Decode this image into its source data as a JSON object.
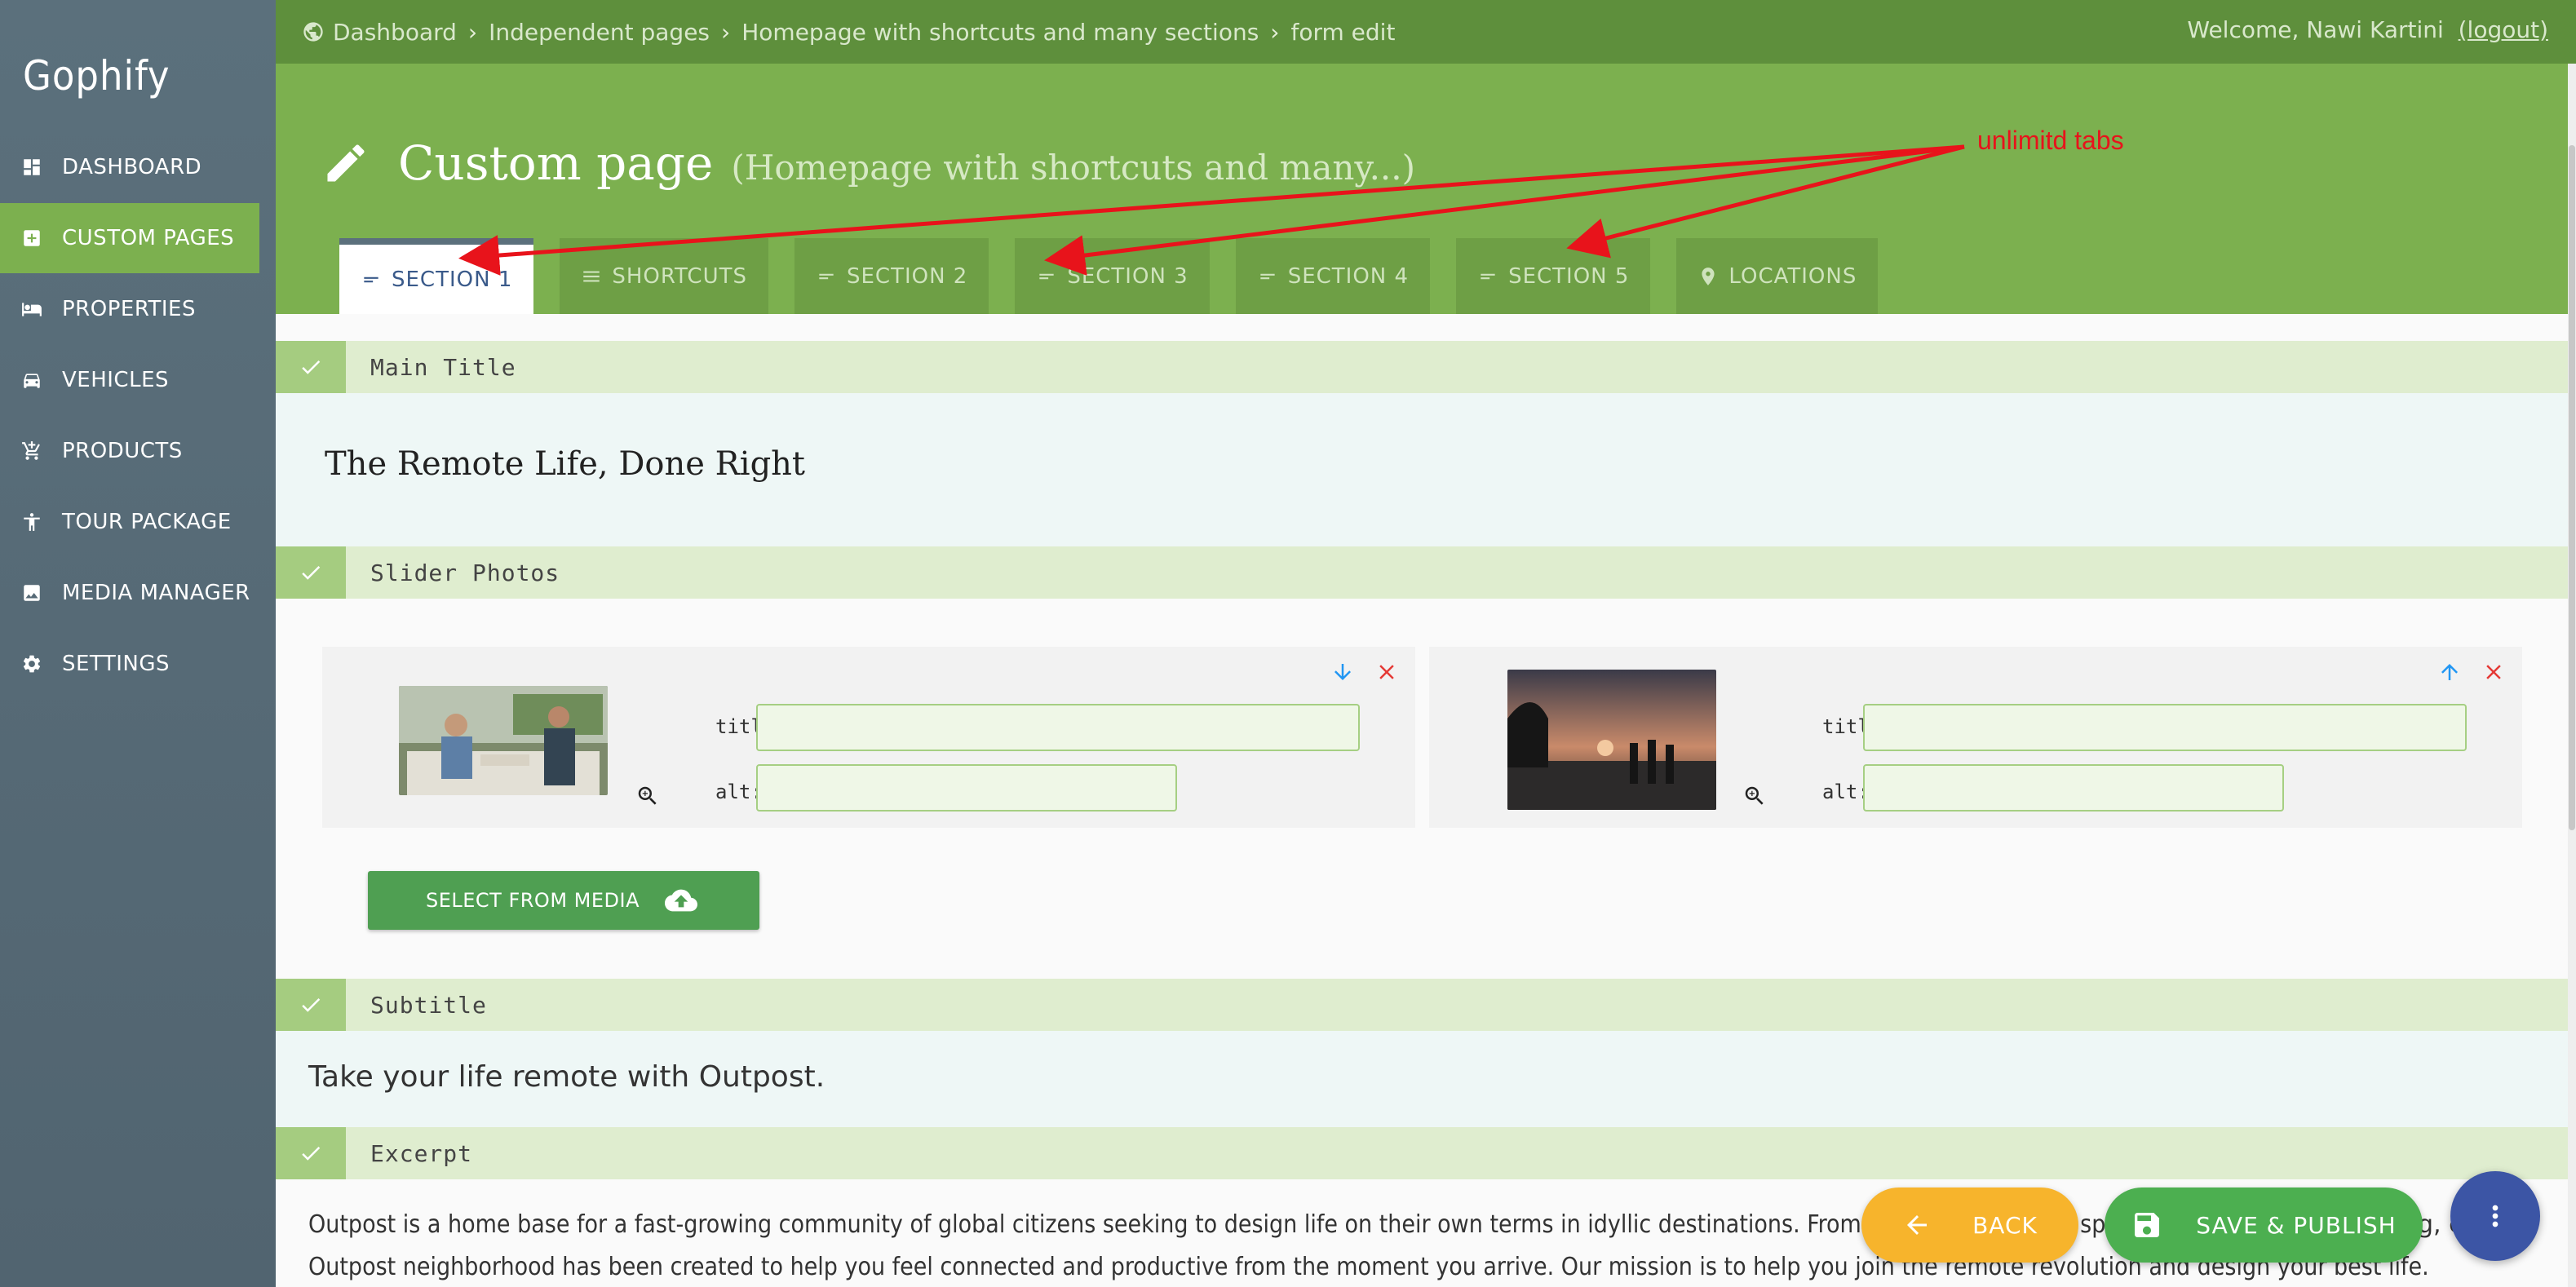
{
  "sidebar": {
    "brand": "Gophify",
    "items": [
      {
        "label": "DASHBOARD",
        "icon": "dashboard-icon"
      },
      {
        "label": "CUSTOM PAGES",
        "icon": "custom-pages-icon",
        "active": true
      },
      {
        "label": "PROPERTIES",
        "icon": "bed-icon"
      },
      {
        "label": "VEHICLES",
        "icon": "car-icon"
      },
      {
        "label": "PRODUCTS",
        "icon": "cart-icon"
      },
      {
        "label": "TOUR PACKAGE",
        "icon": "person-icon"
      },
      {
        "label": "MEDIA MANAGER",
        "icon": "image-icon"
      },
      {
        "label": "SETTINGS",
        "icon": "gear-icon"
      }
    ]
  },
  "topbar": {
    "breadcrumbs": [
      "Dashboard",
      "Independent pages",
      "Homepage with shortcuts and many sections",
      "form edit"
    ],
    "welcome": "Welcome, Nawi Kartini",
    "logout": "(logout)"
  },
  "page": {
    "title": "Custom page",
    "subtitle": "(Homepage with shortcuts and many...)"
  },
  "tabs": [
    {
      "label": "SECTION 1",
      "icon": "short-text-icon",
      "active": true
    },
    {
      "label": "SHORTCUTS",
      "icon": "menu-icon"
    },
    {
      "label": "SECTION 2",
      "icon": "short-text-icon"
    },
    {
      "label": "SECTION 3",
      "icon": "short-text-icon"
    },
    {
      "label": "SECTION 4",
      "icon": "short-text-icon"
    },
    {
      "label": "SECTION 5",
      "icon": "short-text-icon"
    },
    {
      "label": "LOCATIONS",
      "icon": "location-pin-icon"
    }
  ],
  "sections": {
    "main_title": {
      "label": "Main Title",
      "value": "The Remote Life, Done Right"
    },
    "slider_photos": {
      "label": "Slider Photos",
      "photos": [
        {
          "title_label": "title:",
          "title_value": "",
          "alt_label": "alt:",
          "alt_value": ""
        },
        {
          "title_label": "title:",
          "title_value": "",
          "alt_label": "alt:",
          "alt_value": ""
        }
      ],
      "select_button": "SELECT FROM MEDIA"
    },
    "subtitle": {
      "label": "Subtitle",
      "value": "Take your life remote with Outpost."
    },
    "excerpt": {
      "label": "Excerpt",
      "line1": "Outpost is a home base for a fast-growing community of global citizens seeking to design life on their own terms in idyllic destinations. From modern coworking spaces and a commun",
      "line1_tail": "g, e",
      "line2": "Outpost neighborhood has been created to help you feel connected and productive from the moment you arrive. Our mission is to help you join the remote revolution and design your best life."
    }
  },
  "actions": {
    "back": "BACK",
    "save": "SAVE & PUBLISH"
  },
  "annotation": {
    "text": "unlimitd tabs"
  },
  "colors": {
    "primary_green": "#7cb04f",
    "dark_green": "#5e8f3c",
    "sidebar": "#56696f",
    "back": "#f7b42c",
    "save": "#4caf50",
    "fab": "#3c55a5",
    "annotation": "#e8131b"
  }
}
